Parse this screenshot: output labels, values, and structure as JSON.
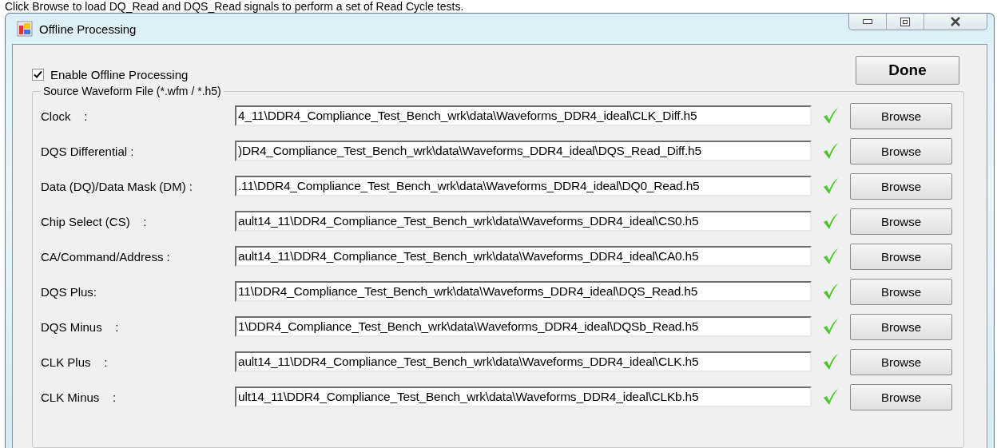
{
  "instruction": "Click Browse to load DQ_Read and DQS_Read signals to perform a set of Read Cycle tests.",
  "window": {
    "title": "Offline Processing"
  },
  "enable_offline_processing": {
    "label": "Enable Offline Processing",
    "checked": true
  },
  "done_button": "Done",
  "source_group": {
    "title": "Source Waveform File (*.wfm / *.h5)",
    "rows": [
      {
        "label": "Clock    :",
        "path": "4_11\\DDR4_Compliance_Test_Bench_wrk\\data\\Waveforms_DDR4_ideal\\CLK_Diff.h5",
        "valid": true,
        "button": "Browse"
      },
      {
        "label": "DQS Differential :",
        "path": ")DR4_Compliance_Test_Bench_wrk\\data\\Waveforms_DDR4_ideal\\DQS_Read_Diff.h5",
        "valid": true,
        "button": "Browse"
      },
      {
        "label": "Data (DQ)/Data Mask (DM) :",
        "path": ".11\\DDR4_Compliance_Test_Bench_wrk\\data\\Waveforms_DDR4_ideal\\DQ0_Read.h5",
        "valid": true,
        "button": "Browse"
      },
      {
        "label": "Chip Select (CS)    :",
        "path": "ault14_11\\DDR4_Compliance_Test_Bench_wrk\\data\\Waveforms_DDR4_ideal\\CS0.h5",
        "valid": true,
        "button": "Browse"
      },
      {
        "label": "CA/Command/Address :",
        "path": "ault14_11\\DDR4_Compliance_Test_Bench_wrk\\data\\Waveforms_DDR4_ideal\\CA0.h5",
        "valid": true,
        "button": "Browse"
      },
      {
        "label": "DQS Plus:",
        "path": "11\\DDR4_Compliance_Test_Bench_wrk\\data\\Waveforms_DDR4_ideal\\DQS_Read.h5",
        "valid": true,
        "button": "Browse"
      },
      {
        "label": "DQS Minus    :",
        "path": "1\\DDR4_Compliance_Test_Bench_wrk\\data\\Waveforms_DDR4_ideal\\DQSb_Read.h5",
        "valid": true,
        "button": "Browse"
      },
      {
        "label": "CLK Plus    :",
        "path": "ault14_11\\DDR4_Compliance_Test_Bench_wrk\\data\\Waveforms_DDR4_ideal\\CLK.h5",
        "valid": true,
        "button": "Browse"
      },
      {
        "label": "CLK Minus    :",
        "path": "ult14_11\\DDR4_Compliance_Test_Bench_wrk\\data\\Waveforms_DDR4_ideal\\CLKb.h5",
        "valid": true,
        "button": "Browse"
      }
    ]
  }
}
